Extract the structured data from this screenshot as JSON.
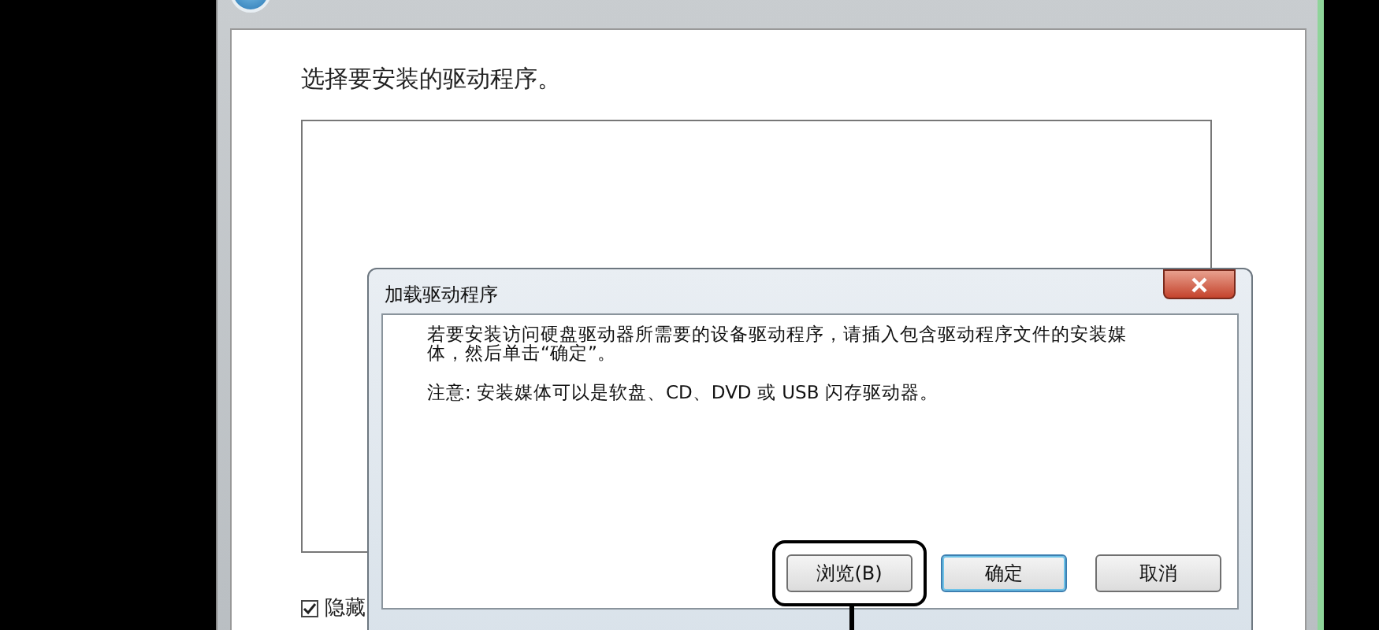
{
  "wizard": {
    "heading": "选择要安装的驱动程序。",
    "hide_option": {
      "label": "隐藏",
      "checked": true
    }
  },
  "dialog": {
    "title": "加载驱动程序",
    "message": "若要安装访问硬盘驱动器所需要的设备驱动程序，请插入包含驱动程序文件的安装媒体，然后单击“确定”。",
    "note": "注意: 安装媒体可以是软盘、CD、DVD 或 USB 闪存驱动器。",
    "buttons": [
      {
        "label": "浏览(B)",
        "default": false,
        "highlighted": true
      },
      {
        "label": "确定",
        "default": true,
        "highlighted": false
      },
      {
        "label": "取消",
        "default": false,
        "highlighted": false
      }
    ]
  }
}
